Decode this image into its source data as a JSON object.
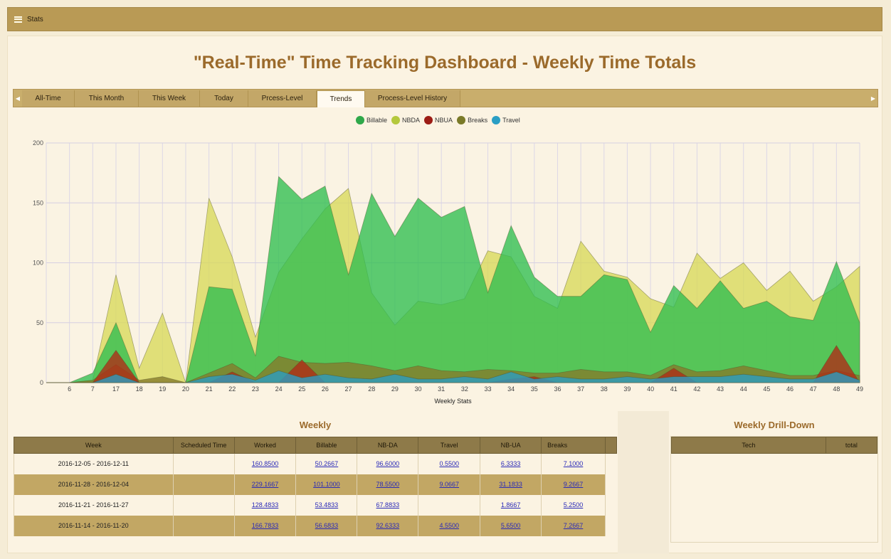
{
  "topbar": {
    "title": "Stats"
  },
  "page": {
    "title": "\"Real-Time\" Time Tracking Dashboard - Weekly Time Totals"
  },
  "tabs": [
    {
      "label": "All-Time"
    },
    {
      "label": "This Month"
    },
    {
      "label": "This Week"
    },
    {
      "label": "Today"
    },
    {
      "label": "Prcess-Level"
    },
    {
      "label": "Trends"
    },
    {
      "label": "Process-Level History"
    }
  ],
  "active_tab": "Trends",
  "legend": [
    {
      "label": "Billable",
      "color": "#2fa84a"
    },
    {
      "label": "NBDA",
      "color": "#b4c83c"
    },
    {
      "label": "NBUA",
      "color": "#9c1c14"
    },
    {
      "label": "Breaks",
      "color": "#7a7a28"
    },
    {
      "label": "Travel",
      "color": "#2a9ec4"
    }
  ],
  "chart_data": {
    "type": "area",
    "xlabel": "Weekly Stats",
    "ylabel": "",
    "ylim": [
      0,
      200
    ],
    "yticks": [
      0,
      50,
      100,
      150,
      200
    ],
    "categories": [
      "",
      "6",
      "7",
      "17",
      "18",
      "19",
      "20",
      "21",
      "22",
      "23",
      "24",
      "25",
      "26",
      "27",
      "28",
      "29",
      "30",
      "31",
      "32",
      "33",
      "34",
      "35",
      "36",
      "37",
      "38",
      "39",
      "40",
      "41",
      "42",
      "43",
      "44",
      "45",
      "46",
      "47",
      "48",
      "49"
    ],
    "series": [
      {
        "name": "NBDA",
        "color": "#d8d85a",
        "values": [
          0,
          0,
          2,
          90,
          12,
          58,
          0,
          154,
          105,
          38,
          92,
          120,
          145,
          162,
          75,
          48,
          68,
          65,
          70,
          110,
          105,
          72,
          62,
          118,
          93,
          88,
          70,
          63,
          108,
          87,
          100,
          77,
          93,
          68,
          80,
          97
        ]
      },
      {
        "name": "Billable",
        "color": "#2fbe50",
        "values": [
          0,
          0,
          8,
          50,
          0,
          0,
          0,
          80,
          78,
          22,
          172,
          153,
          164,
          90,
          158,
          122,
          154,
          138,
          147,
          75,
          131,
          88,
          72,
          72,
          90,
          86,
          42,
          81,
          62,
          85,
          62,
          68,
          55,
          52,
          101,
          50
        ]
      },
      {
        "name": "Breaks",
        "color": "#857a2a",
        "values": [
          0,
          0,
          2,
          15,
          2,
          5,
          0,
          8,
          16,
          4,
          22,
          17,
          16,
          17,
          14,
          10,
          14,
          10,
          9,
          11,
          10,
          8,
          8,
          11,
          9,
          9,
          6,
          15,
          9,
          10,
          14,
          10,
          6,
          6,
          10,
          6
        ]
      },
      {
        "name": "NBUA",
        "color": "#b02a16",
        "values": [
          0,
          0,
          0,
          27,
          0,
          0,
          0,
          0,
          9,
          0,
          0,
          19,
          0,
          0,
          0,
          0,
          0,
          0,
          0,
          0,
          3,
          5,
          0,
          0,
          0,
          0,
          0,
          12,
          0,
          0,
          0,
          0,
          0,
          0,
          31,
          0
        ]
      },
      {
        "name": "Travel",
        "color": "#2a9ec4",
        "values": [
          0,
          0,
          0,
          7,
          0,
          0,
          0,
          5,
          7,
          2,
          10,
          4,
          7,
          4,
          3,
          7,
          3,
          3,
          5,
          3,
          9,
          3,
          5,
          3,
          3,
          5,
          3,
          5,
          5,
          5,
          7,
          5,
          3,
          3,
          9,
          2
        ]
      }
    ]
  },
  "weekly": {
    "title": "Weekly",
    "headers": [
      "Week",
      "Scheduled Time",
      "Worked",
      "Billable",
      "NB-DA",
      "Travel",
      "NB-UA",
      "Breaks"
    ],
    "rows": [
      {
        "week": "2016-12-05 - 2016-12-11",
        "scheduled": "",
        "worked": "160.8500",
        "billable": "50.2667",
        "nbda": "96.6000",
        "travel": "0.5500",
        "nbua": "6.3333",
        "breaks": "7.1000"
      },
      {
        "week": "2016-11-28 - 2016-12-04",
        "scheduled": "",
        "worked": "229.1667",
        "billable": "101.1000",
        "nbda": "78.5500",
        "travel": "9.0667",
        "nbua": "31.1833",
        "breaks": "9.2667"
      },
      {
        "week": "2016-11-21 - 2016-11-27",
        "scheduled": "",
        "worked": "128.4833",
        "billable": "53.4833",
        "nbda": "67.8833",
        "travel": "",
        "nbua": "1.8667",
        "breaks": "5.2500"
      },
      {
        "week": "2016-11-14 - 2016-11-20",
        "scheduled": "",
        "worked": "166.7833",
        "billable": "56.6833",
        "nbda": "92.6333",
        "travel": "4.5500",
        "nbua": "5.6500",
        "breaks": "7.2667"
      }
    ]
  },
  "drilldown": {
    "title": "Weekly Drill-Down",
    "headers": [
      "Tech",
      "total"
    ]
  }
}
